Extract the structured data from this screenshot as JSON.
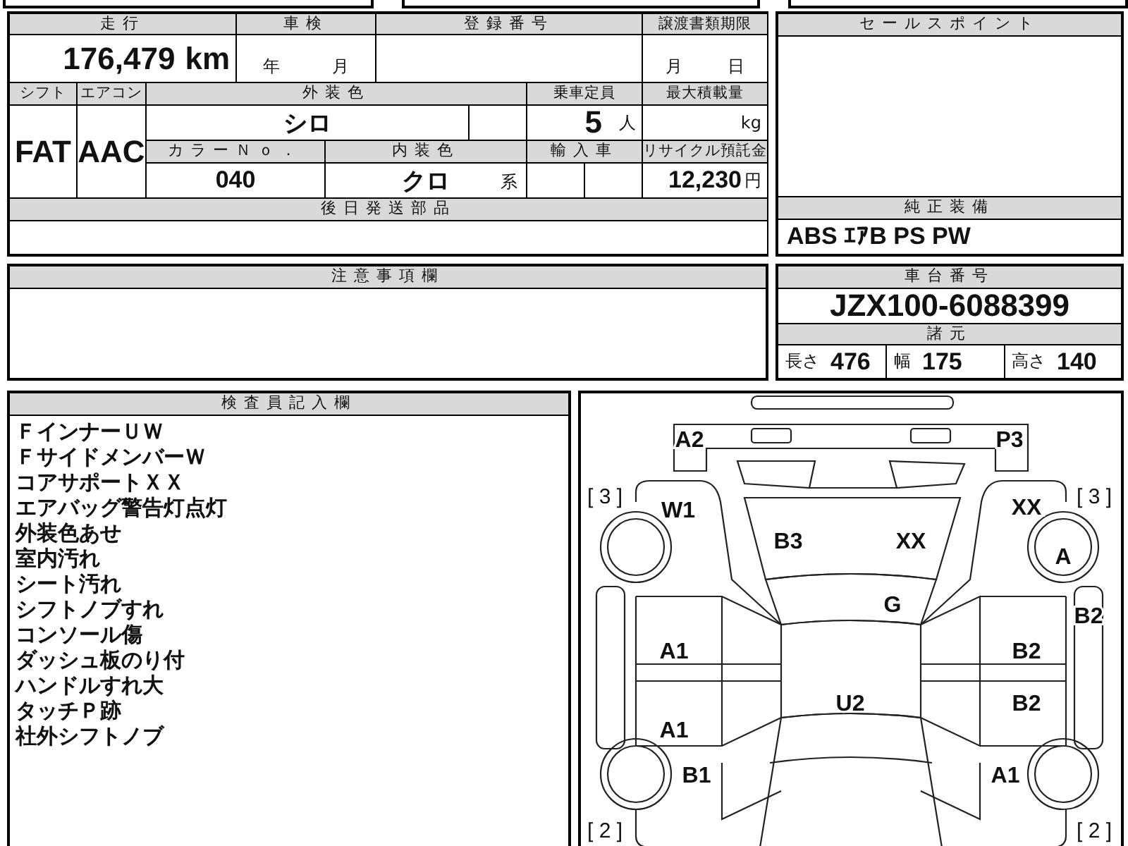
{
  "mileage": {
    "label": "走行",
    "value": "176,479",
    "unit": "km"
  },
  "inspection": {
    "label": "車検",
    "year": "年",
    "month": "月"
  },
  "registration": {
    "label": "登録番号"
  },
  "transfer_deadline": {
    "label": "譲渡書類期限",
    "month": "月",
    "day": "日"
  },
  "shift": {
    "label": "シフト",
    "value": "FAT"
  },
  "aircon": {
    "label": "エアコン",
    "value": "AAC"
  },
  "exterior_color": {
    "label": "外装色",
    "value": "シロ"
  },
  "capacity": {
    "label": "乗車定員",
    "value": "5",
    "unit": "人"
  },
  "max_load": {
    "label": "最大積載量",
    "unit": "kg"
  },
  "color_no": {
    "label": "カラーＮｏ．",
    "value": "040"
  },
  "interior_color": {
    "label": "内装色",
    "value": "クロ",
    "suffix": "系"
  },
  "import": {
    "label": "輸入車"
  },
  "recycle_fee": {
    "label": "リサイクル預託金",
    "value": "12,230",
    "unit": "円"
  },
  "later_parts": {
    "label": "後日発送部品"
  },
  "sales_point": {
    "label": "セールスポイント"
  },
  "standard_equipment": {
    "label": "純正装備",
    "value": "ABS ｴｱB PS PW"
  },
  "notes": {
    "label": "注意事項欄"
  },
  "chassis": {
    "label": "車台番号",
    "value": "JZX100-6088399",
    "specs_label": "諸元",
    "specs": [
      {
        "label": "長さ",
        "value": "476"
      },
      {
        "label": "幅",
        "value": "175"
      },
      {
        "label": "高さ",
        "value": "140"
      }
    ]
  },
  "inspector_notes": {
    "label": "検査員記入欄",
    "lines": [
      "ＦインナーＵＷ",
      "ＦサイドメンバーＷ",
      "コアサポートＸＸ",
      "エアバッグ警告灯点灯",
      "外装色あせ",
      "室内汚れ",
      "シート汚れ",
      "シフトノブすれ",
      "コンソール傷",
      "ダッシュ板のり付",
      "ハンドルすれ大",
      "タッチＰ跡",
      "社外シフトノブ"
    ]
  },
  "damage_map": {
    "tire_grades": {
      "front_left": "[ 3 ]",
      "front_right": "[ 3 ]",
      "rear_left": "[ 2 ]",
      "rear_right": "[ 2 ]"
    },
    "marks": {
      "front_bumper_left": "A2",
      "front_bumper_right": "P3",
      "front_fender_left": "W1",
      "hood_left": "B3",
      "hood_right": "XX",
      "front_fender_right": "XX",
      "front_wheel_right": "A",
      "windshield": "G",
      "sill_right": "B2",
      "front_door_left": "A1",
      "front_door_right": "B2",
      "roof": "U2",
      "rear_door_right": "B2",
      "rear_door_left": "A1",
      "rear_fender_left": "B1",
      "rear_fender_right": "A1"
    }
  }
}
